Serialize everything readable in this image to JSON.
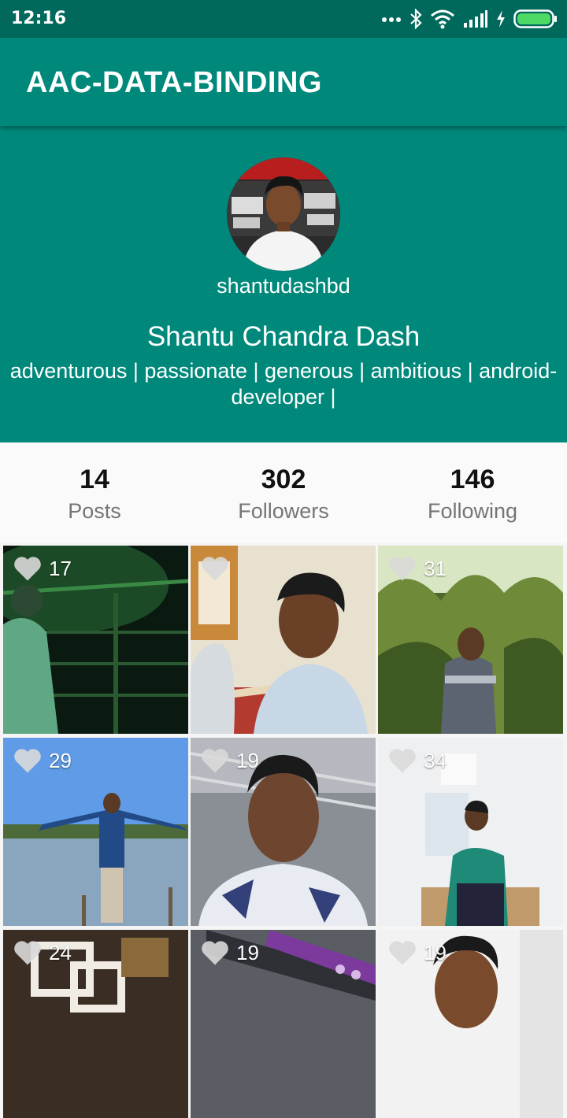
{
  "status_bar": {
    "time": "12:16",
    "icons": [
      "more-dots-icon",
      "bluetooth-icon",
      "wifi-icon",
      "signal-icon",
      "charging-icon",
      "battery-icon"
    ]
  },
  "app_bar": {
    "title": "AAC-DATA-BINDING"
  },
  "profile": {
    "username": "shantudashbd",
    "full_name": "Shantu Chandra Dash",
    "bio": "adventurous | passionate | generous | ambitious | android-developer |"
  },
  "stats": [
    {
      "value": "14",
      "label": "Posts"
    },
    {
      "value": "302",
      "label": "Followers"
    },
    {
      "value": "146",
      "label": "Following"
    }
  ],
  "posts": [
    {
      "likes": "17"
    },
    {
      "likes": ""
    },
    {
      "likes": "31"
    },
    {
      "likes": "29"
    },
    {
      "likes": "19"
    },
    {
      "likes": "34"
    },
    {
      "likes": "24"
    },
    {
      "likes": "19"
    },
    {
      "likes": "19"
    }
  ],
  "colors": {
    "primary": "#00897b",
    "primary_dark": "#00695c",
    "heart": "#d9d9d9"
  }
}
